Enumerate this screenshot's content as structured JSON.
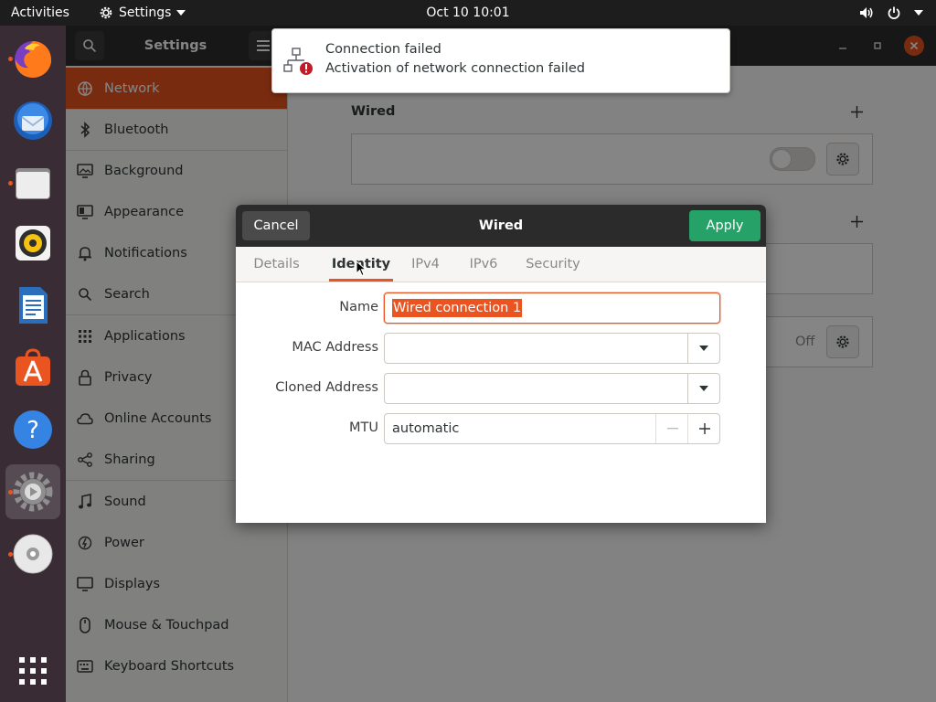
{
  "topbar": {
    "activities": "Activities",
    "app_menu": "Settings",
    "clock": "Oct 10  10:01"
  },
  "dock": {
    "apps": [
      {
        "name": "firefox",
        "running": true
      },
      {
        "name": "thunderbird",
        "running": false
      },
      {
        "name": "files",
        "running": true
      },
      {
        "name": "rhythmbox",
        "running": false
      },
      {
        "name": "libreoffice-writer",
        "running": false
      },
      {
        "name": "ubuntu-software",
        "running": false
      },
      {
        "name": "help",
        "running": false
      },
      {
        "name": "settings",
        "running": true
      },
      {
        "name": "dvd",
        "running": true
      }
    ]
  },
  "header": {
    "title": "Settings"
  },
  "sidebar": {
    "items": [
      {
        "label": "Network",
        "icon": "network-icon",
        "selected": true
      },
      {
        "label": "Bluetooth",
        "icon": "bluetooth-icon"
      },
      {
        "label": "Background",
        "icon": "background-icon"
      },
      {
        "label": "Appearance",
        "icon": "appearance-icon"
      },
      {
        "label": "Notifications",
        "icon": "bell-icon"
      },
      {
        "label": "Search",
        "icon": "search-icon"
      },
      {
        "label": "Applications",
        "icon": "applications-icon"
      },
      {
        "label": "Privacy",
        "icon": "lock-icon"
      },
      {
        "label": "Online Accounts",
        "icon": "cloud-icon"
      },
      {
        "label": "Sharing",
        "icon": "share-icon"
      },
      {
        "label": "Sound",
        "icon": "music-note-icon"
      },
      {
        "label": "Power",
        "icon": "power-icon"
      },
      {
        "label": "Displays",
        "icon": "display-icon"
      },
      {
        "label": "Mouse & Touchpad",
        "icon": "mouse-icon"
      },
      {
        "label": "Keyboard Shortcuts",
        "icon": "keyboard-icon"
      }
    ]
  },
  "content": {
    "wired_heading": "Wired",
    "vpn_status": "Off"
  },
  "notification": {
    "title": "Connection failed",
    "body": "Activation of network connection failed"
  },
  "dialog": {
    "cancel_label": "Cancel",
    "title": "Wired",
    "apply_label": "Apply",
    "tabs": [
      "Details",
      "Identity",
      "IPv4",
      "IPv6",
      "Security"
    ],
    "active_tab": "Identity",
    "fields": {
      "name_label": "Name",
      "name_value": "Wired connection 1",
      "mac_label": "MAC Address",
      "mac_value": "",
      "cloned_label": "Cloned Address",
      "cloned_value": "",
      "mtu_label": "MTU",
      "mtu_value": "automatic"
    }
  },
  "colors": {
    "accent": "#e95420",
    "apply": "#26a269",
    "dock_bg": "#3a2c35",
    "topbar_bg": "#1d1d1d"
  }
}
